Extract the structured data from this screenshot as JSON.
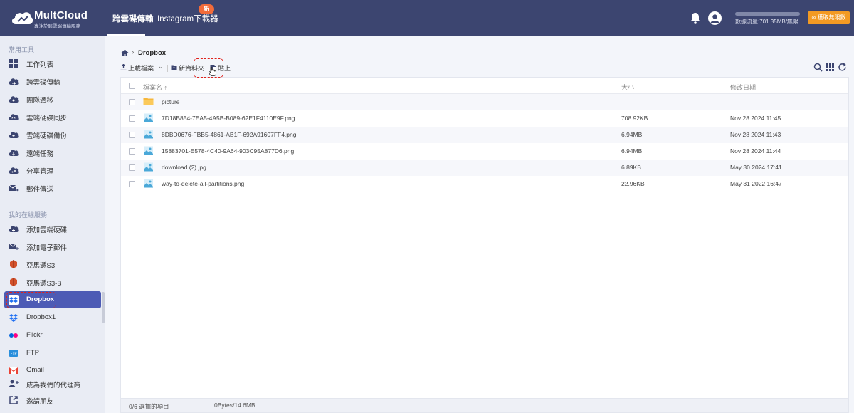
{
  "app": {
    "name": "MultCloud",
    "tagline": "專注於跨雲端傳輸服務"
  },
  "topnav": {
    "tabs": [
      {
        "label": "跨雲碟傳輸",
        "active": true
      },
      {
        "label": "Instagram下載器",
        "active": false
      }
    ],
    "new_badge": "新",
    "traffic_text": "數據流量:701.35MB/無限",
    "upgrade_label": "獲取無限數"
  },
  "sidebar": {
    "tools_title": "常用工具",
    "tools": [
      {
        "label": "工作列表",
        "icon": "grid-icon"
      },
      {
        "label": "跨雲碟傳輸",
        "icon": "cloud-transfer-icon"
      },
      {
        "label": "團隊遷移",
        "icon": "team-migrate-icon"
      },
      {
        "label": "雲端硬碟同步",
        "icon": "cloud-sync-icon"
      },
      {
        "label": "雲端硬碟備份",
        "icon": "cloud-backup-icon"
      },
      {
        "label": "遠端任務",
        "icon": "remote-upload-icon"
      },
      {
        "label": "分享管理",
        "icon": "share-icon"
      },
      {
        "label": "郵件傳送",
        "icon": "email-migrate-icon"
      }
    ],
    "online_title": "我的在線服務",
    "online": [
      {
        "label": "添加雲端硬碟",
        "icon": "add-cloud-icon",
        "active": false
      },
      {
        "label": "添加電子郵件",
        "icon": "add-email-icon",
        "active": false
      },
      {
        "label": "亞馬遜S3",
        "icon": "amazon-s3-icon",
        "active": false
      },
      {
        "label": "亞馬遜S3-B",
        "icon": "amazon-s3-icon",
        "active": false
      },
      {
        "label": "Dropbox",
        "icon": "dropbox-icon",
        "active": true
      },
      {
        "label": "Dropbox1",
        "icon": "dropbox-icon",
        "active": false
      },
      {
        "label": "Flickr",
        "icon": "flickr-icon",
        "active": false
      },
      {
        "label": "FTP",
        "icon": "ftp-icon",
        "active": false
      },
      {
        "label": "Gmail",
        "icon": "gmail-icon",
        "active": false
      },
      {
        "label": "成為我們的代理商",
        "icon": "partner-icon",
        "active": false
      },
      {
        "label": "邀請朋友",
        "icon": "invite-icon",
        "active": false
      }
    ]
  },
  "breadcrumb": {
    "current": "Dropbox"
  },
  "toolbar": {
    "upload_label": "上載檔案",
    "new_folder_label": "新資料夾",
    "paste_label": "貼上"
  },
  "table": {
    "headers": {
      "name": "檔案名",
      "size": "大小",
      "date": "修改日期"
    },
    "rows": [
      {
        "name": "picture",
        "size": "",
        "date": "",
        "type": "folder"
      },
      {
        "name": "7D18B854-7EA5-4A5B-B089-62E1F4110E9F.png",
        "size": "708.92KB",
        "date": "Nov 28 2024 11:45",
        "type": "image"
      },
      {
        "name": "8DBD0676-FBB5-4861-AB1F-692A91607FF4.png",
        "size": "6.94MB",
        "date": "Nov 28 2024 11:43",
        "type": "image"
      },
      {
        "name": "15883701-E578-4C40-9A64-903C95A877D6.png",
        "size": "6.94MB",
        "date": "Nov 28 2024 11:44",
        "type": "image"
      },
      {
        "name": "download (2).jpg",
        "size": "6.89KB",
        "date": "May 30 2024 17:41",
        "type": "image"
      },
      {
        "name": "way-to-delete-all-partitions.png",
        "size": "22.96KB",
        "date": "May 31 2022 16:47",
        "type": "image"
      }
    ]
  },
  "footer": {
    "selected": "0/6 選擇的項目",
    "total": "0Bytes/14.6MB"
  },
  "colors": {
    "topbar": "#3c4570",
    "active_item": "#4d5bb5",
    "upgrade": "#f39a23",
    "highlight_dash": "#e0201a",
    "folder": "#f7b73b",
    "image_icon": "#4aa8d8"
  }
}
